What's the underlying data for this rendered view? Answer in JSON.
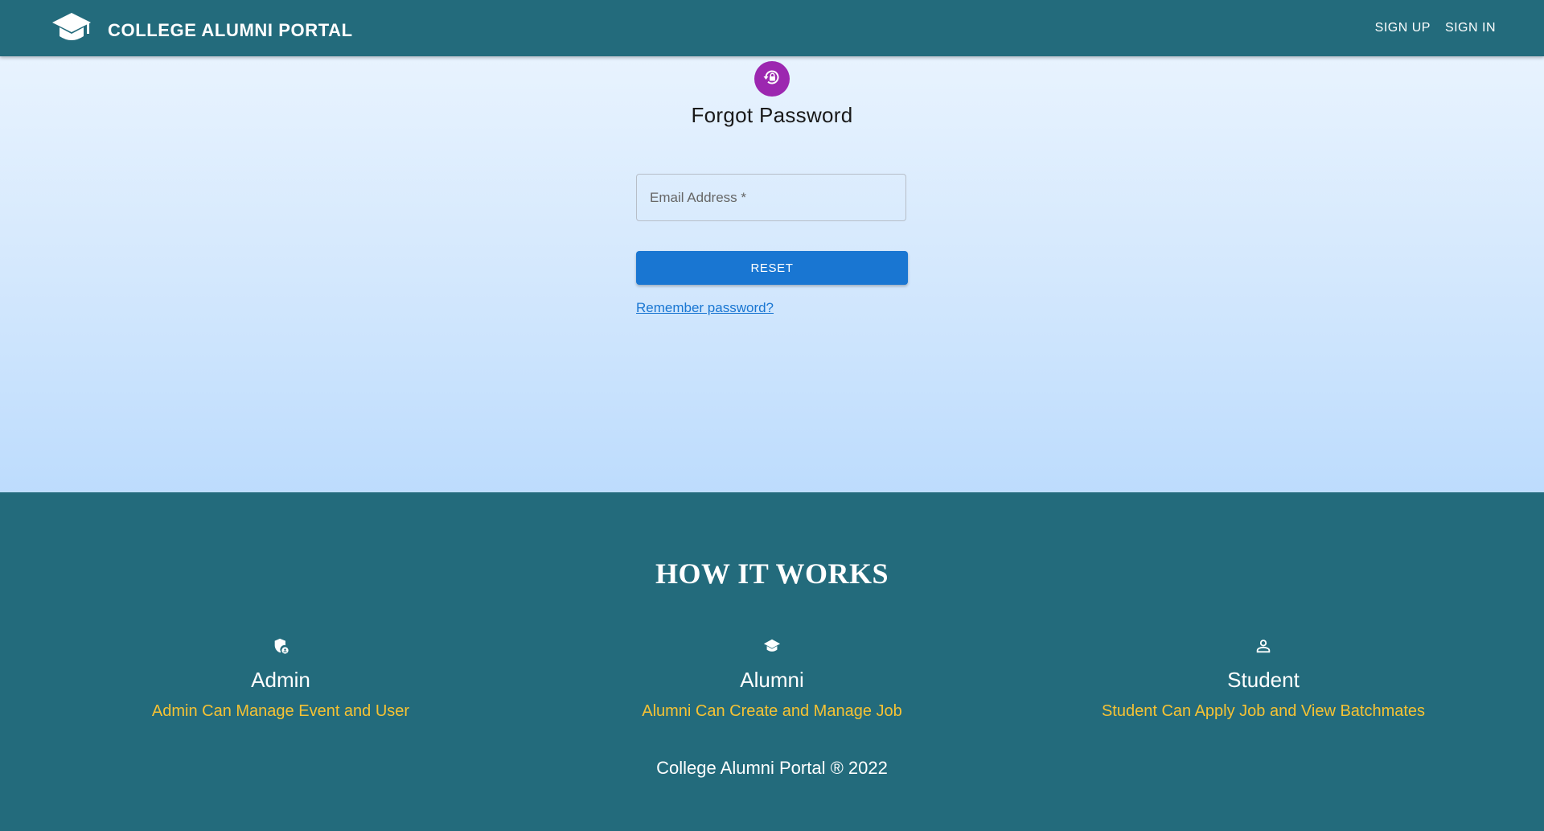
{
  "header": {
    "brand_title": "COLLEGE ALUMNI PORTAL",
    "brand_icon": "graduation-cap-icon",
    "nav": {
      "sign_up": "SIGN UP",
      "sign_in": "SIGN IN"
    },
    "background_color": "#236b7c"
  },
  "form": {
    "avatar_icon": "lock-reset-icon",
    "avatar_color": "#9c27b0",
    "title": "Forgot Password",
    "email_placeholder": "Email Address *",
    "email_value": "",
    "reset_label": "RESET",
    "reset_color": "#1976d2",
    "remember_link": "Remember password?"
  },
  "how_it_works": {
    "title": "HOW IT WORKS",
    "roles": [
      {
        "icon": "admin-shield-icon",
        "name": "Admin",
        "description": "Admin Can Manage Event and User"
      },
      {
        "icon": "graduation-cap-icon",
        "name": "Alumni",
        "description": "Alumni Can Create and Manage Job"
      },
      {
        "icon": "person-icon",
        "name": "Student",
        "description": "Student Can Apply Job and View Batchmates"
      }
    ],
    "description_color": "#f6c233"
  },
  "footer": {
    "copyright": "College Alumni Portal ® 2022"
  }
}
